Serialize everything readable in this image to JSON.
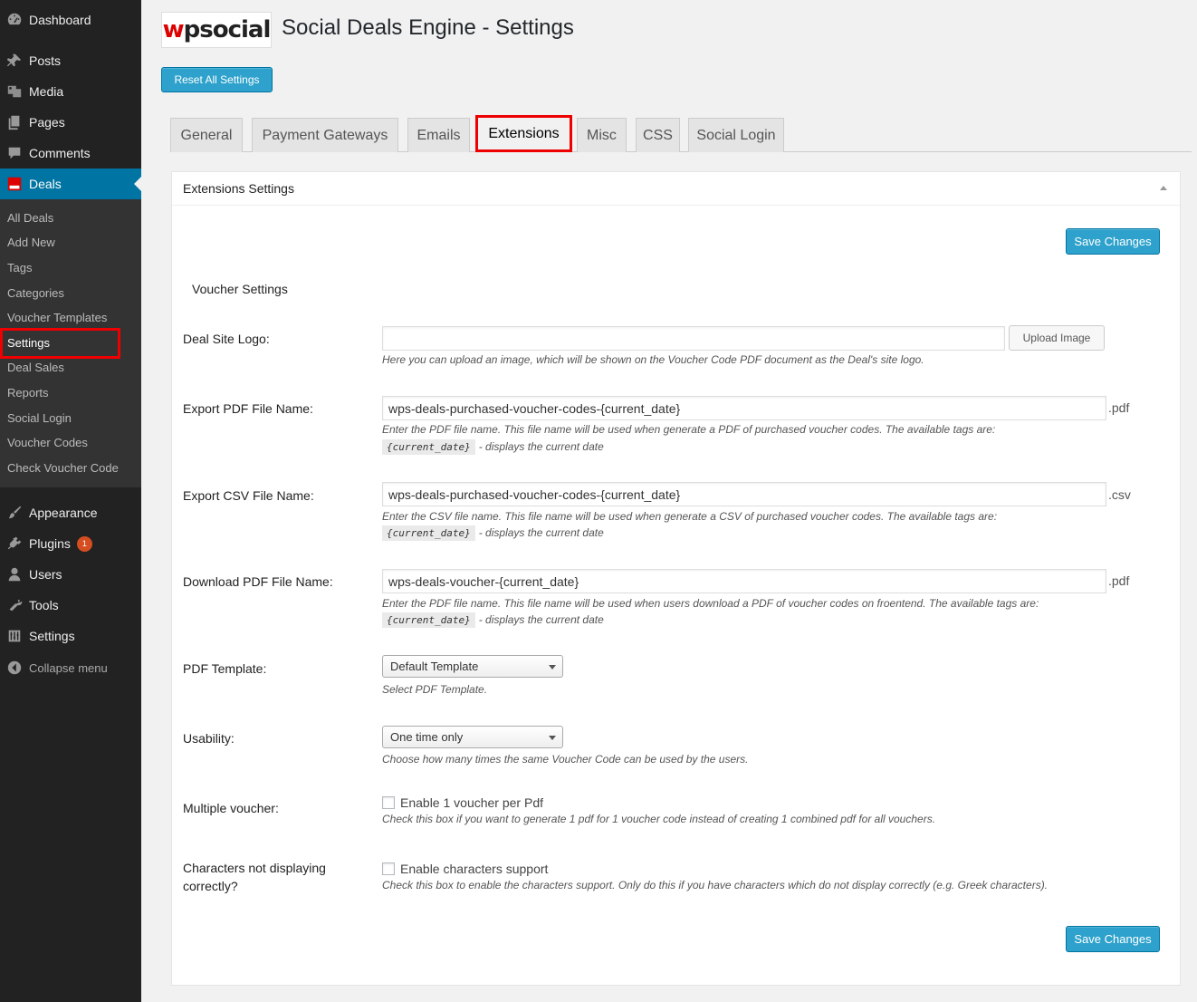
{
  "sidebar": {
    "menu": [
      {
        "label": "Dashboard",
        "icon": "dashboard-icon"
      },
      {
        "label": "Posts",
        "icon": "pin-icon"
      },
      {
        "label": "Media",
        "icon": "media-icon"
      },
      {
        "label": "Pages",
        "icon": "pages-icon"
      },
      {
        "label": "Comments",
        "icon": "comment-icon"
      },
      {
        "label": "Deals",
        "icon": "wpsocial-icon"
      }
    ],
    "submenu": [
      "All Deals",
      "Add New",
      "Tags",
      "Categories",
      "Voucher Templates",
      "Settings",
      "Deal Sales",
      "Reports",
      "Social Login",
      "Voucher Codes",
      "Check Voucher Code"
    ],
    "menu2": [
      {
        "label": "Appearance",
        "icon": "paintbrush-icon"
      },
      {
        "label": "Plugins",
        "icon": "plugin-icon",
        "badge": "1"
      },
      {
        "label": "Users",
        "icon": "user-icon"
      },
      {
        "label": "Tools",
        "icon": "wrench-icon"
      },
      {
        "label": "Settings",
        "icon": "settings-icon"
      }
    ],
    "collapse": "Collapse menu"
  },
  "header": {
    "logo_w": "w",
    "logo_rest": "psocial",
    "title": "Social Deals Engine - Settings",
    "reset": "Reset All Settings"
  },
  "tabs": [
    "General",
    "Payment Gateways",
    "Emails",
    "Extensions",
    "Misc",
    "CSS",
    "Social Login"
  ],
  "panel": {
    "title": "Extensions Settings",
    "save": "Save Changes",
    "section": "Voucher Settings",
    "logo": {
      "label": "Deal Site Logo:",
      "value": "",
      "upload": "Upload Image",
      "desc": "Here you can upload an image, which will be shown on the Voucher Code PDF document as the Deal's site logo."
    },
    "export_pdf": {
      "label": "Export PDF File Name:",
      "value": "wps-deals-purchased-voucher-codes-{current_date}",
      "suffix": ".pdf",
      "desc": "Enter the PDF file name. This file name will be used when generate a PDF of purchased voucher codes. The available tags are:",
      "tag": "{current_date}",
      "tag_desc": "- displays the current date"
    },
    "export_csv": {
      "label": "Export CSV File Name:",
      "value": "wps-deals-purchased-voucher-codes-{current_date}",
      "suffix": ".csv",
      "desc": "Enter the CSV file name. This file name will be used when generate a CSV of purchased voucher codes. The available tags are:",
      "tag": "{current_date}",
      "tag_desc": "- displays the current date"
    },
    "download_pdf": {
      "label": "Download PDF File Name:",
      "value": "wps-deals-voucher-{current_date}",
      "suffix": ".pdf",
      "desc": "Enter the PDF file name. This file name will be used when users download a PDF of voucher codes on froentend. The available tags are:",
      "tag": "{current_date}",
      "tag_desc": "- displays the current date"
    },
    "pdf_template": {
      "label": "PDF Template:",
      "value": "Default Template",
      "desc": "Select PDF Template."
    },
    "usability": {
      "label": "Usability:",
      "value": "One time only",
      "desc": "Choose how many times the same Voucher Code can be used by the users."
    },
    "multiple": {
      "label": "Multiple voucher:",
      "checkbox": "Enable 1 voucher per Pdf",
      "desc": "Check this box if you want to generate 1 pdf for 1 voucher code instead of creating 1 combined pdf for all vouchers."
    },
    "chars": {
      "label1": "Characters not displaying",
      "label2": "correctly?",
      "checkbox": "Enable characters support",
      "desc": "Check this box to enable the characters support. Only do this if you have characters which do not display correctly (e.g. Greek characters)."
    }
  },
  "colors": {
    "accent": "#2ea2cc",
    "active_menu": "#0074a2",
    "highlight": "#e00000"
  }
}
